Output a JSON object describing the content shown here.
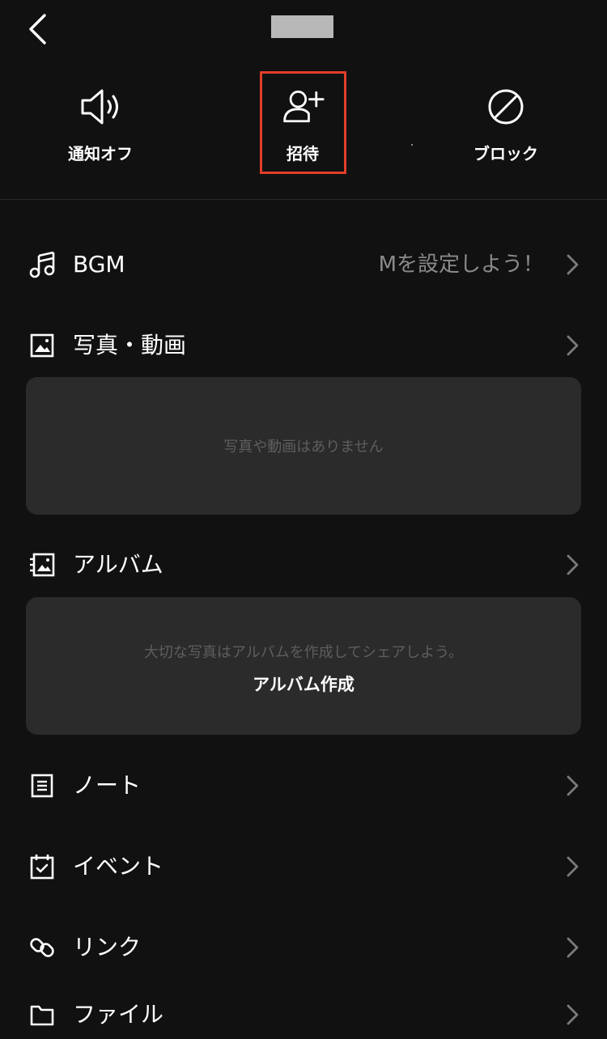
{
  "header": {
    "back_icon": "chevron-left-icon"
  },
  "actions": {
    "mute": {
      "label": "通知オフ",
      "icon": "speaker-icon"
    },
    "invite": {
      "label": "招待",
      "icon": "add-person-icon"
    },
    "block": {
      "label": "ブロック",
      "icon": "block-icon"
    }
  },
  "highlight_color": "#e23e2a",
  "bgm": {
    "label": "BGM",
    "value": "Mを設定しよう！",
    "icon": "music-note-icon"
  },
  "photos": {
    "label": "写真・動画",
    "icon": "photo-icon",
    "empty_text": "写真や動画はありません"
  },
  "album": {
    "label": "アルバム",
    "icon": "album-icon",
    "empty_text": "大切な写真はアルバムを作成してシェアしよう。",
    "create_label": "アルバム作成"
  },
  "note": {
    "label": "ノート",
    "icon": "note-icon"
  },
  "event": {
    "label": "イベント",
    "icon": "calendar-icon"
  },
  "link": {
    "label": "リンク",
    "icon": "link-icon"
  },
  "file": {
    "label": "ファイル",
    "icon": "folder-icon"
  }
}
